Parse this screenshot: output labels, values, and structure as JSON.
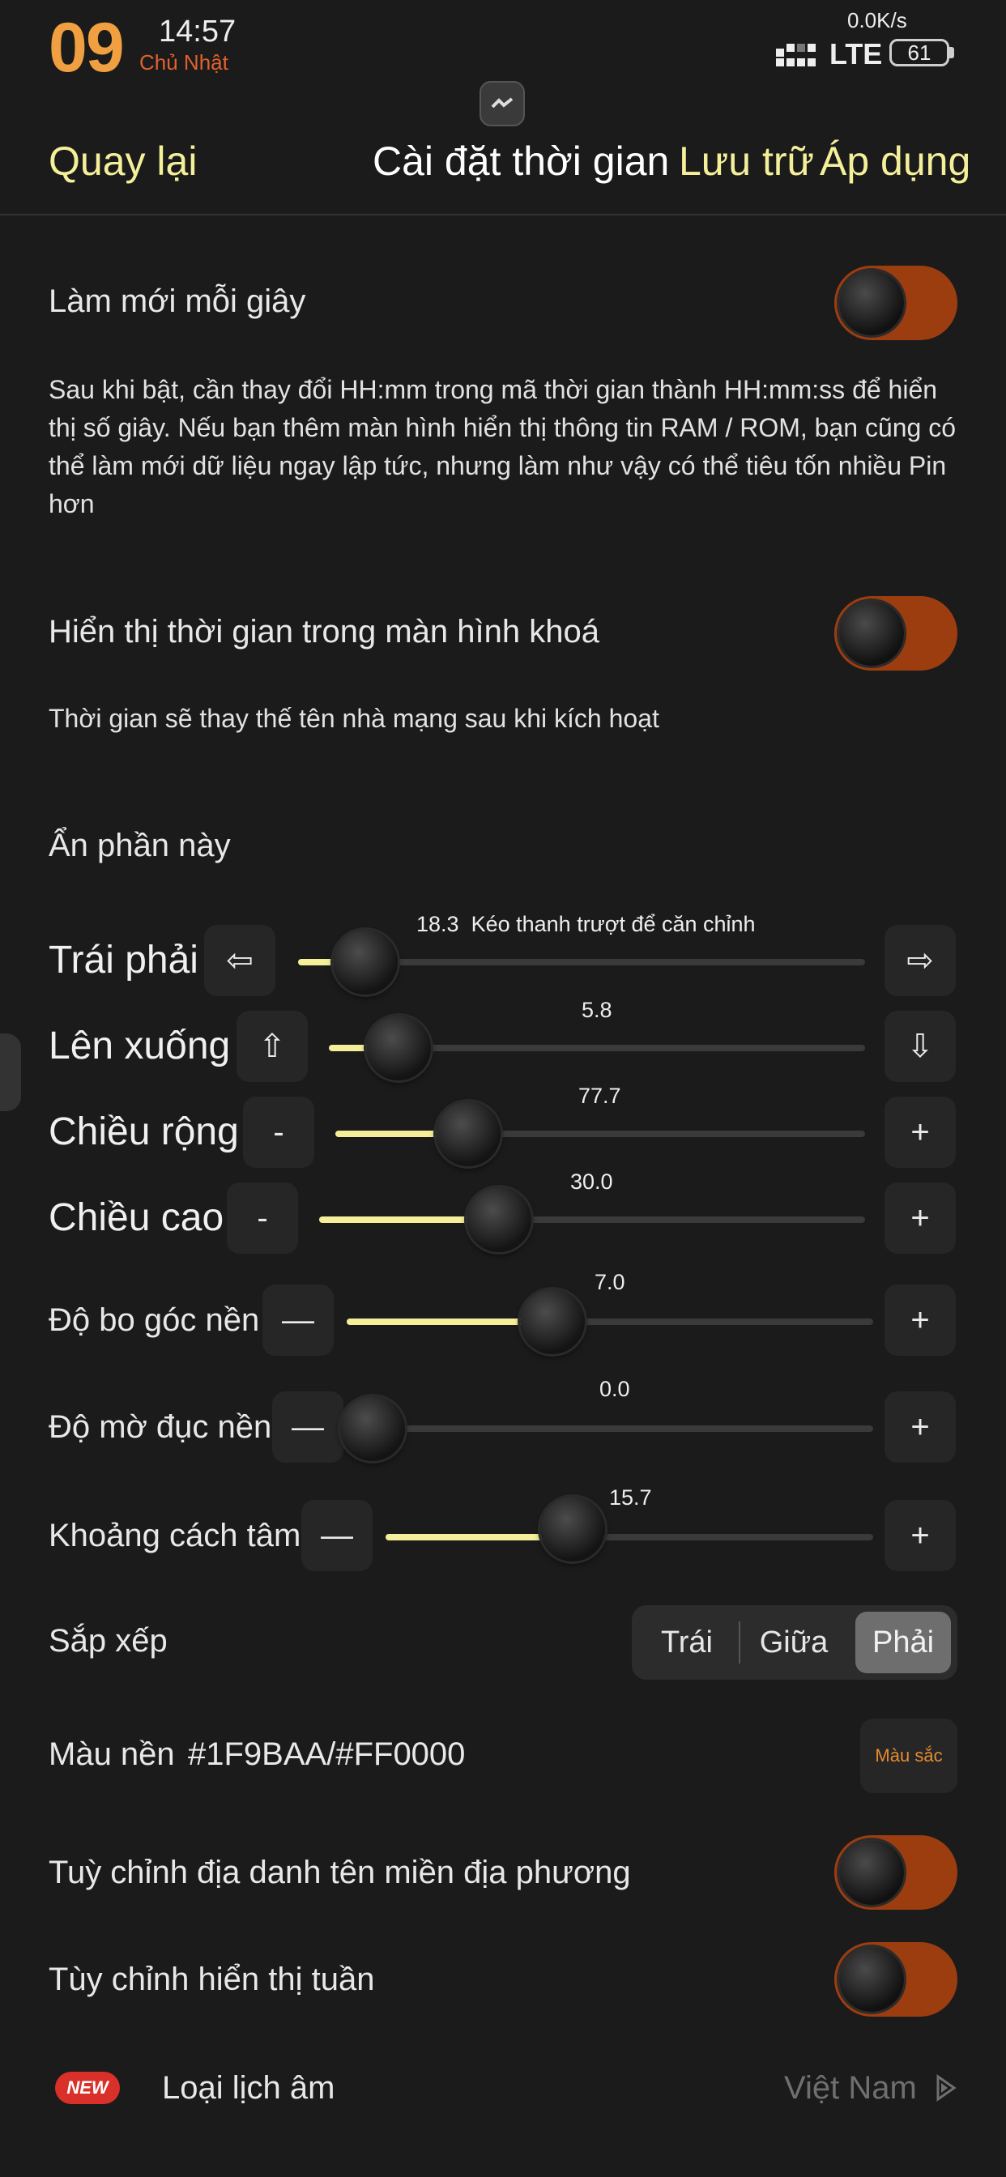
{
  "status_bar": {
    "day": "09",
    "time": "14:57",
    "weekday": "Chủ Nhật",
    "net_speed": "0.0K/s",
    "network": "LTE",
    "battery": "61"
  },
  "header": {
    "back": "Quay lại",
    "title": "Cài đặt thời gian",
    "save": "Lưu trữ",
    "apply": "Áp dụng"
  },
  "refresh_row": {
    "label": "Làm mới mỗi giây",
    "toggle_state": "on",
    "description": "Sau khi bật, cần thay đổi HH:mm trong mã thời gian thành HH:mm:ss để hiển thị số giây. Nếu bạn thêm màn hình hiển thị thông tin RAM / ROM, bạn cũng có thể làm mới dữ liệu ngay lập tức, nhưng làm như vậy có thể tiêu tốn nhiều Pin hơn"
  },
  "lockscreen_row": {
    "label": "Hiển thị thời gian trong màn hình khoá",
    "toggle_state": "on",
    "description": "Thời gian sẽ thay thế tên nhà mạng sau khi kích hoạt"
  },
  "hide_section": {
    "label": "Ẩn phần này"
  },
  "sliders": {
    "horizontal": {
      "label": "Trái phải",
      "value": "18.3",
      "hint": "Kéo thanh trượt để căn chỉnh",
      "fraction": 0.09,
      "dec": "⇦",
      "inc": "⇨"
    },
    "vertical": {
      "label": "Lên xuống",
      "value": "5.8",
      "fraction": 0.1,
      "dec": "⇧",
      "inc": "⇩"
    },
    "width": {
      "label": "Chiều rộng",
      "value": "77.7",
      "fraction": 0.22,
      "dec": "-",
      "inc": "+"
    },
    "height": {
      "label": "Chiều cao",
      "value": "30.0",
      "fraction": 0.3,
      "dec": "-",
      "inc": "+"
    },
    "corner": {
      "label": "Độ bo góc nền",
      "value": "7.0",
      "fraction": 0.36,
      "dec": "—",
      "inc": "+"
    },
    "opacity": {
      "label": "Độ mờ đục nền",
      "value": "0.0",
      "fraction": 0.0,
      "dec": "—",
      "inc": "+"
    },
    "spacing": {
      "label": "Khoảng cách tâm",
      "value": "15.7",
      "fraction": 0.35,
      "dec": "—",
      "inc": "+"
    }
  },
  "arrange": {
    "label": "Sắp xếp",
    "options": [
      "Trái",
      "Giữa",
      "Phải"
    ],
    "selected": "Phải"
  },
  "background_color": {
    "label": "Màu nền",
    "value": "#1F9BAA/#FF0000",
    "button": "Màu sắc"
  },
  "local_domain_row": {
    "label": "Tuỳ chỉnh địa danh tên miền địa phương",
    "toggle_state": "on"
  },
  "week_row": {
    "label": "Tùy chỉnh hiển thị tuần",
    "toggle_state": "on"
  },
  "lunar_row": {
    "badge": "NEW",
    "label": "Loại lịch âm",
    "value": "Việt Nam"
  },
  "colors": {
    "accent_yellow": "#f5ef9a",
    "toggle_on": "#9c3d10",
    "background": "#1b1b1b",
    "badge_red": "#d9302a",
    "color_button_text": "#e68a2e"
  }
}
